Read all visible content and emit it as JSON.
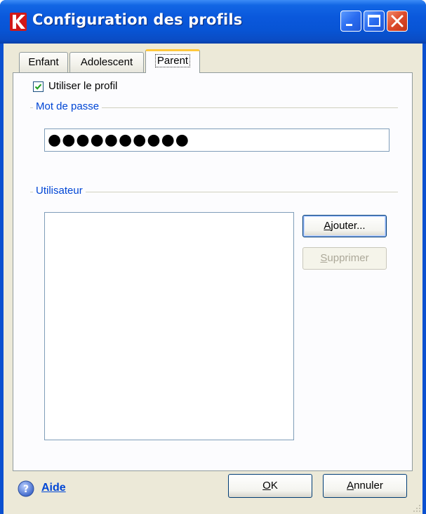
{
  "window": {
    "title": "Configuration des profils",
    "icon": "kaspersky-k-icon",
    "controls": [
      "minimize-icon",
      "maximize-icon",
      "close-icon"
    ]
  },
  "tabs": [
    {
      "label": "Enfant",
      "active": false
    },
    {
      "label": "Adolescent",
      "active": false
    },
    {
      "label": "Parent",
      "active": true
    }
  ],
  "profile": {
    "use_profile_label": "Utiliser le profil",
    "use_profile_checked": true
  },
  "password_group": {
    "label": "Mot de passe",
    "value": "●●●●●●●●●●"
  },
  "user_group": {
    "label": "Utilisateur",
    "items": [],
    "add_button": {
      "prefix": "",
      "mnemonic": "A",
      "rest": "jouter..."
    },
    "remove_button": {
      "prefix": "",
      "mnemonic": "S",
      "rest": "upprimer",
      "disabled": true
    }
  },
  "footer": {
    "help_label": "Aide",
    "help_icon": "help-question-icon",
    "ok_button": {
      "prefix": "",
      "mnemonic": "O",
      "rest": "K"
    },
    "cancel_button": {
      "prefix": "",
      "mnemonic": "A",
      "rest": "nnuler"
    }
  },
  "colors": {
    "titlebar": "#0a58dc",
    "dialog_bg": "#ece9d8",
    "group_label": "#0046d5",
    "tab_highlight": "#ffc83c",
    "check": "#21a121"
  }
}
